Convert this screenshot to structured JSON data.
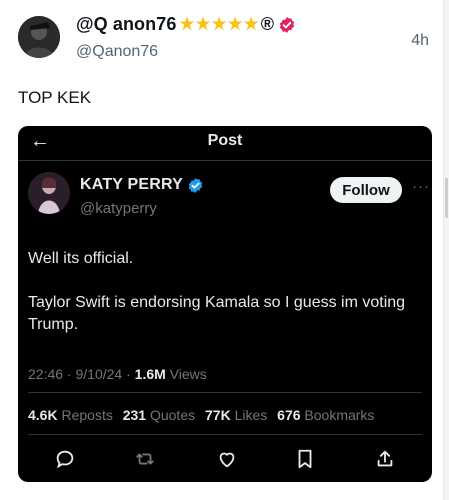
{
  "post": {
    "display_name": "@Q anon76",
    "stars": [
      "★",
      "★",
      "★",
      "★",
      "★"
    ],
    "reg_mark": "®",
    "handle": "@Qanon76",
    "time": "4h",
    "text": "TOP KEK"
  },
  "embed": {
    "topbar": {
      "back_glyph": "←",
      "title": "Post"
    },
    "author": {
      "name": "KATY PERRY",
      "handle": "@katyperry"
    },
    "follow_label": "Follow",
    "more_glyph": "···",
    "tweet": {
      "line1": "Well its official.",
      "line2": "Taylor Swift is endorsing Kamala so I guess im voting Trump."
    },
    "meta": {
      "time": "22:46",
      "sep1": " · ",
      "date": "9/10/24",
      "sep2": " · ",
      "views_count": "1.6M",
      "views_label": " Views"
    },
    "stats": [
      {
        "num": "4.6K",
        "label": "Reposts"
      },
      {
        "num": "231",
        "label": "Quotes"
      },
      {
        "num": "77K",
        "label": "Likes"
      },
      {
        "num": "676",
        "label": "Bookmarks"
      }
    ],
    "actions": [
      "reply-icon",
      "repost-icon",
      "like-icon",
      "bookmark-icon",
      "share-icon"
    ]
  },
  "colors": {
    "star": "#f7c21a",
    "verified_pink": "#e0245e",
    "verified_blue": "#1d9bf0",
    "embed_bg": "#000000"
  }
}
